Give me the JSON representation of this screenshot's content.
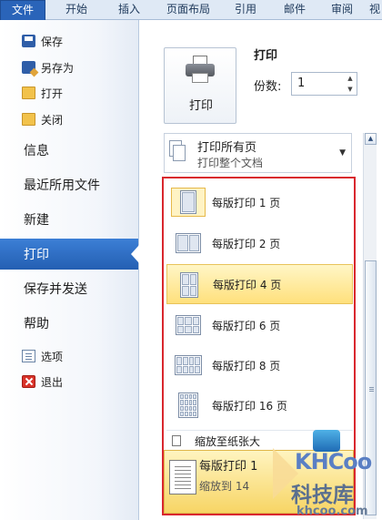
{
  "ribbon": {
    "tabs": [
      {
        "label": "文件",
        "active": true
      },
      {
        "label": "开始"
      },
      {
        "label": "插入"
      },
      {
        "label": "页面布局"
      },
      {
        "label": "引用"
      },
      {
        "label": "邮件"
      },
      {
        "label": "审阅"
      },
      {
        "label": "视"
      }
    ]
  },
  "nav": {
    "save": "保存",
    "save_as": "另存为",
    "open": "打开",
    "close": "关闭",
    "info": "信息",
    "recent": "最近所用文件",
    "new": "新建",
    "print": "打印",
    "save_send": "保存并发送",
    "help": "帮助",
    "options": "选项",
    "exit": "退出"
  },
  "print_panel": {
    "heading": "打印",
    "print_button": "打印",
    "copies_label": "份数:",
    "copies_value": "1",
    "what_to_print": {
      "title": "打印所有页",
      "subtitle": "打印整个文档"
    },
    "pages_per_sheet_options": [
      {
        "label": "每版打印 1 页",
        "selected": true
      },
      {
        "label": "每版打印 2 页"
      },
      {
        "label": "每版打印 4 页",
        "highlighted": true
      },
      {
        "label": "每版打印 6 页"
      },
      {
        "label": "每版打印 8 页"
      },
      {
        "label": "每版打印 16 页"
      }
    ],
    "scale_to_paper": "缩放至纸张大",
    "current_setting": {
      "title": "每版打印 1",
      "subtitle": "缩放到 14"
    }
  },
  "watermark": {
    "brand": "KHCoo",
    "name": "科技库",
    "url": "khcoo.com"
  },
  "colors": {
    "accent": "#2a64b9",
    "highlight": "#ffe07c",
    "annotation_border": "#d9272e"
  }
}
